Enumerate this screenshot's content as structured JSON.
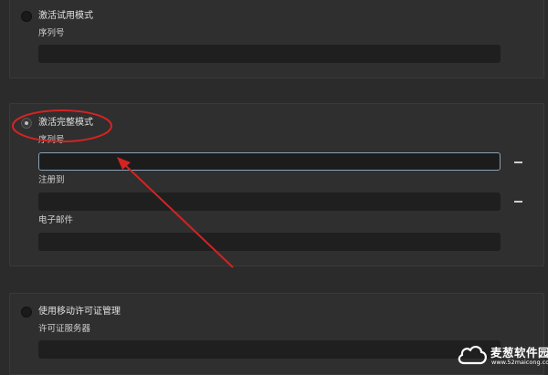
{
  "trial_mode": {
    "option_label": "激活试用模式",
    "serial_label": "序列号",
    "serial_value": ""
  },
  "full_mode": {
    "option_label": "激活完整模式",
    "serial_label": "序列号",
    "serial_value": "",
    "register_to_label": "注册到",
    "register_to_value": "",
    "email_label": "电子邮件",
    "email_value": ""
  },
  "mobile_license": {
    "option_label": "使用移动许可证管理",
    "server_label": "许可证服务器",
    "server_value": ""
  },
  "annotation": {
    "color": "#d42323"
  },
  "watermark": {
    "title": "麦葱软件园",
    "url": "www.52maicong.com"
  },
  "colors": {
    "background": "#2b2b2b",
    "panel": "#2f2f2f",
    "field": "#1f1f1f",
    "focus_border": "#8aa0b5"
  }
}
